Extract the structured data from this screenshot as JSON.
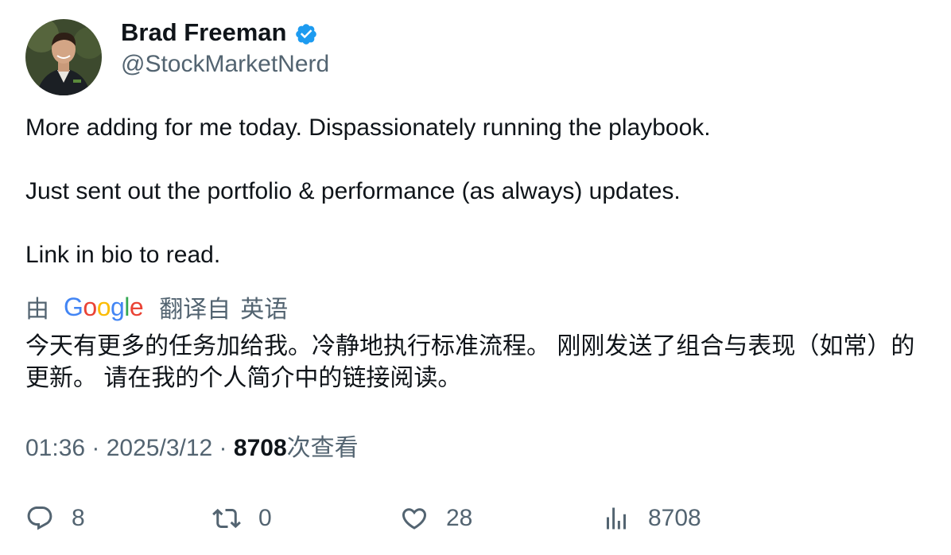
{
  "author": {
    "name": "Brad Freeman",
    "handle": "@StockMarketNerd",
    "verified": true,
    "verified_color": "#1d9bf0"
  },
  "tweet": {
    "lines": [
      "More adding for me today. Dispassionately running the playbook.",
      "Just sent out the portfolio & performance (as always) updates.",
      "Link in bio to read."
    ]
  },
  "translation": {
    "by_label": "由",
    "provider": "Google",
    "from_label": "翻译自",
    "language": "英语",
    "text": "今天有更多的任务加给我。冷静地执行标准流程。 刚刚发送了组合与表现（如常）的更新。 请在我的个人简介中的链接阅读。"
  },
  "meta": {
    "time": "01:36",
    "separator": " · ",
    "date": "2025/3/12",
    "views_count": "8708",
    "views_label": "次查看"
  },
  "actions": {
    "replies": "8",
    "retweets": "0",
    "likes": "28",
    "views": "8708"
  },
  "icons": {
    "reply": "reply-icon",
    "retweet": "retweet-icon",
    "like": "heart-icon",
    "views": "analytics-icon",
    "verified": "verified-badge-icon"
  },
  "colors": {
    "text_primary": "#0f1419",
    "text_secondary": "#536471",
    "google_blue": "#4285F4",
    "google_red": "#EA4335",
    "google_yellow": "#FBBC05",
    "google_green": "#34A853"
  }
}
